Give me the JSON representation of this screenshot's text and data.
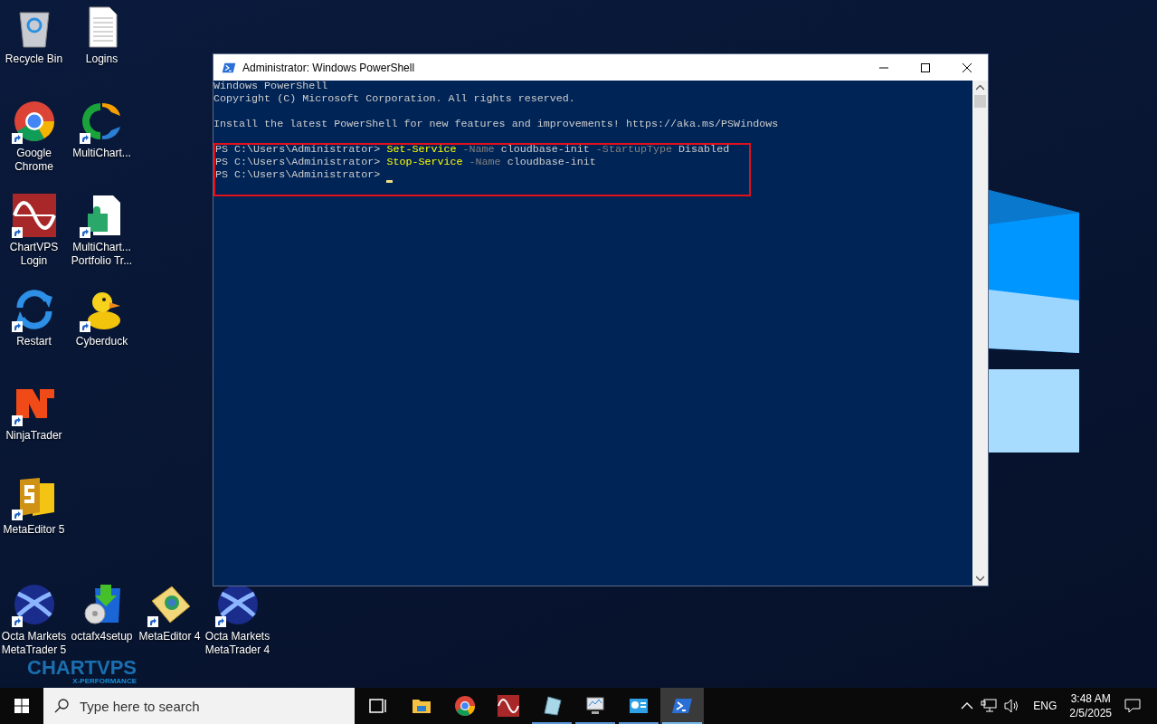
{
  "desktop": {
    "icon_rows": [
      [
        {
          "label": "Recycle Bin",
          "kind": "recycle",
          "shortcut": false
        },
        {
          "label": "Logins",
          "kind": "document",
          "shortcut": false
        }
      ],
      [
        {
          "label": "Google Chrome",
          "kind": "chrome",
          "shortcut": true
        },
        {
          "label": "MultiChart...",
          "kind": "multicharts",
          "shortcut": true
        }
      ],
      [
        {
          "label": "ChartVPS Login",
          "kind": "wave",
          "shortcut": true
        },
        {
          "label": "MultiChart... Portfolio Tr...",
          "kind": "puzzle",
          "shortcut": true
        }
      ],
      [
        {
          "label": "Restart",
          "kind": "restart",
          "shortcut": true
        },
        {
          "label": "Cyberduck",
          "kind": "duck",
          "shortcut": true
        }
      ],
      [
        {
          "label": "NinjaTrader",
          "kind": "ninja",
          "shortcut": true
        }
      ],
      [
        {
          "label": "MetaEditor 5",
          "kind": "editor5",
          "shortcut": true
        }
      ],
      [
        {
          "label": "Octa Markets MetaTrader 5",
          "kind": "octa",
          "shortcut": true
        },
        {
          "label": "octafx4setup",
          "kind": "installer",
          "shortcut": false
        },
        {
          "label": "MetaEditor 4",
          "kind": "editor4",
          "shortcut": true
        },
        {
          "label": "Octa Markets MetaTrader 4",
          "kind": "octa",
          "shortcut": true
        }
      ]
    ],
    "wallpaper_logo": {
      "name": "CHARTVPS",
      "tagline": "X-PERFORMANCE"
    }
  },
  "window": {
    "title": "Administrator: Windows PowerShell",
    "lines": [
      {
        "kind": "output",
        "text": "Windows PowerShell"
      },
      {
        "kind": "output",
        "text": "Copyright (C) Microsoft Corporation. All rights reserved."
      },
      {
        "kind": "blank"
      },
      {
        "kind": "output",
        "text": "Install the latest PowerShell for new features and improvements! https://aka.ms/PSWindows"
      },
      {
        "kind": "blank"
      }
    ],
    "highlighted_lines": [
      {
        "kind": "command",
        "cursor": false,
        "segments": [
          {
            "kind": "prompt",
            "text": "PS C:\\Users\\Administrator>"
          },
          {
            "kind": "cmdlet",
            "text": "Set-Service"
          },
          {
            "kind": "param",
            "text": "-Name"
          },
          {
            "kind": "arg",
            "text": "cloudbase-init"
          },
          {
            "kind": "param",
            "text": "-StartupType"
          },
          {
            "kind": "arg",
            "text": "Disabled"
          }
        ]
      },
      {
        "kind": "command",
        "cursor": false,
        "segments": [
          {
            "kind": "prompt",
            "text": "PS C:\\Users\\Administrator>"
          },
          {
            "kind": "cmdlet",
            "text": "Stop-Service"
          },
          {
            "kind": "param",
            "text": "-Name"
          },
          {
            "kind": "arg",
            "text": "cloudbase-init"
          }
        ]
      },
      {
        "kind": "command",
        "cursor": true,
        "segments": [
          {
            "kind": "prompt",
            "text": "PS C:\\Users\\Administrator>"
          }
        ]
      }
    ]
  },
  "taskbar": {
    "search": {
      "placeholder": "Type here to search"
    },
    "apps": [
      {
        "kind": "taskview",
        "running": false,
        "selected": false
      },
      {
        "kind": "explorer",
        "running": false,
        "selected": false
      },
      {
        "kind": "chrome",
        "running": false,
        "selected": false
      },
      {
        "kind": "wave",
        "running": false,
        "selected": false
      },
      {
        "kind": "glass",
        "running": true,
        "selected": false
      },
      {
        "kind": "monitor",
        "running": true,
        "selected": false
      },
      {
        "kind": "dashboard",
        "running": true,
        "selected": false
      },
      {
        "kind": "powershell",
        "running": true,
        "selected": true
      }
    ],
    "language": "ENG",
    "time": "3:48 AM",
    "date": "2/5/2025"
  }
}
